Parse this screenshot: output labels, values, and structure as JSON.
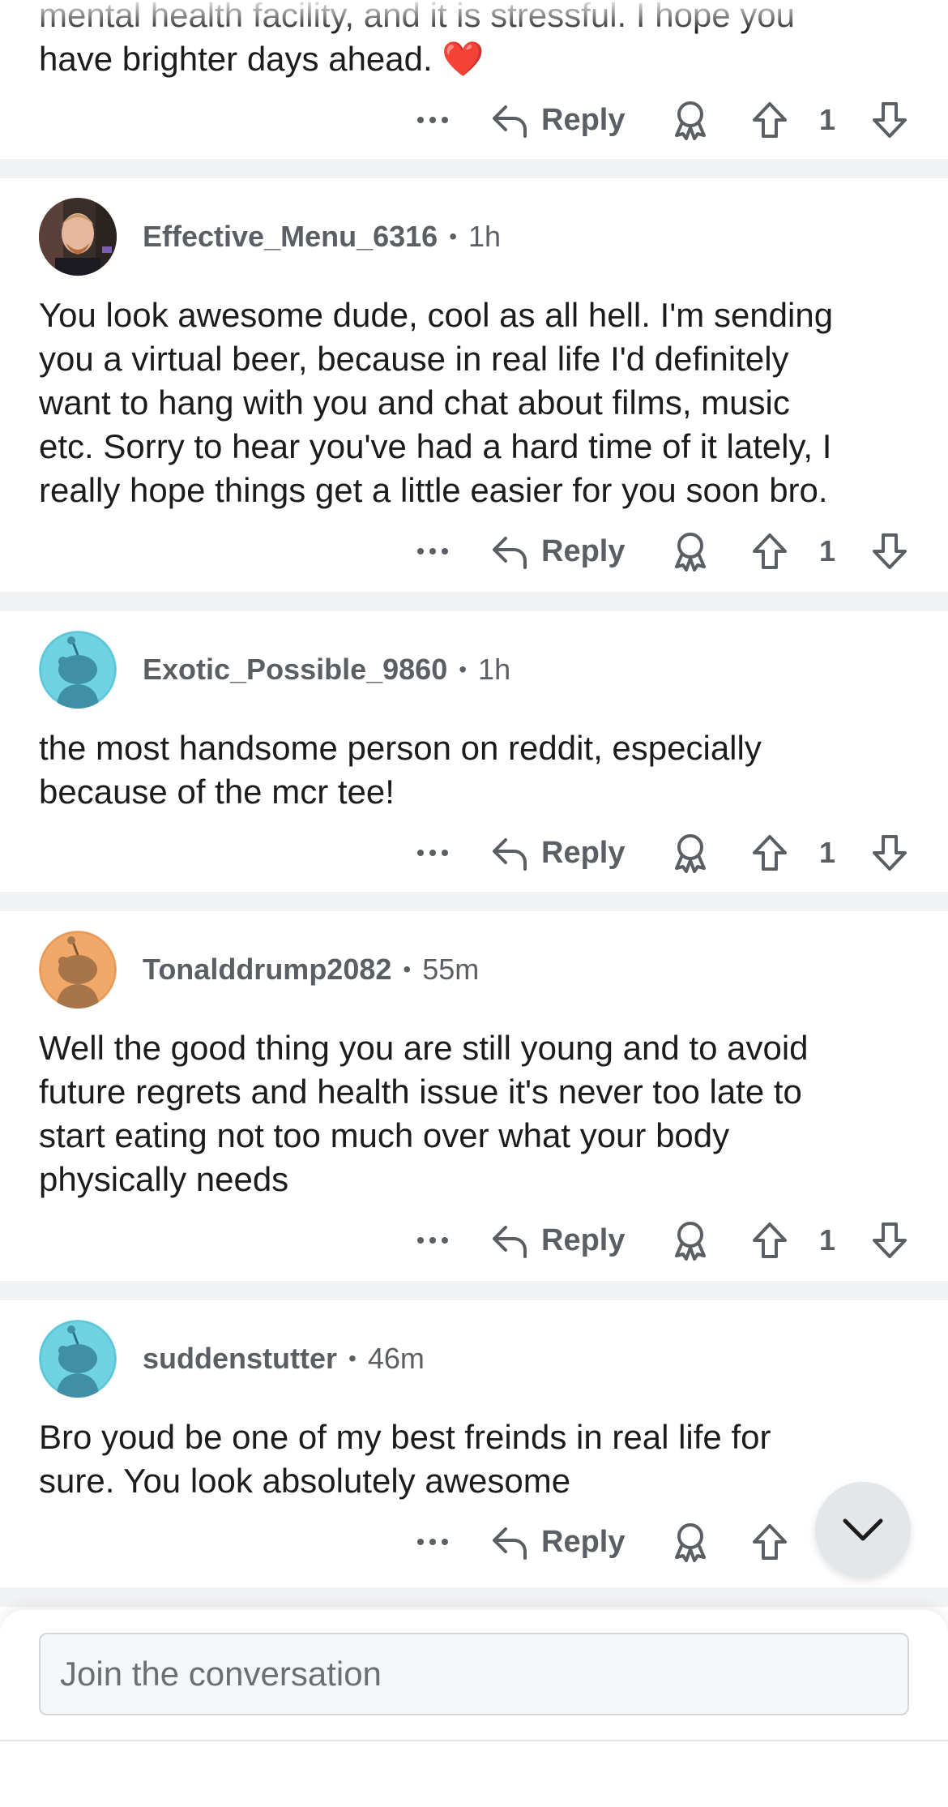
{
  "top_comment": {
    "lines": [
      "mental health facility, and it is stressful. I hope you",
      "have brighter days ahead."
    ],
    "emoji": "❤️",
    "score": "1"
  },
  "comments": [
    {
      "username": "Effective_Menu_6316",
      "age": "1h",
      "avatar": "photo-avatar",
      "lines": [
        "You look awesome dude, cool as all hell. I'm sending",
        "you a virtual beer, because in real life I'd definitely",
        "want to hang with you and chat about films, music",
        "etc. Sorry to hear you've had a hard time of it lately, I",
        "really hope things get a little easier for you soon bro."
      ],
      "score": "1"
    },
    {
      "username": "Exotic_Possible_9860",
      "age": "1h",
      "avatar": "snoo-cyan",
      "lines": [
        "the most handsome person on reddit, especially",
        "because of the mcr tee!"
      ],
      "score": "1"
    },
    {
      "username": "Tonalddrump2082",
      "age": "55m",
      "avatar": "snoo-orange",
      "lines": [
        "Well the good thing you are still young and to avoid",
        "future regrets and health issue it's never too late to",
        "start eating not too much over what your body",
        "physically needs"
      ],
      "score": "1"
    },
    {
      "username": "suddenstutter",
      "age": "46m",
      "avatar": "snoo-cyan",
      "lines": [
        "Bro youd be one of my best freinds in real life for",
        "sure. You look absolutely awesome"
      ],
      "score": ""
    }
  ],
  "actions": {
    "more_icon": "ellipsis-icon",
    "reply_label": "Reply",
    "award_icon": "award-icon",
    "upvote_icon": "upvote-icon",
    "downvote_icon": "downvote-icon"
  },
  "composer": {
    "placeholder": "Join the conversation"
  },
  "scroll_button": {
    "icon": "chevron-down-icon"
  },
  "colors": {
    "background": "#ffffff",
    "separator": "#f1f2f4",
    "meta_text": "#5b5f63",
    "body_text": "#1c1c1c",
    "snoo_cyan": "#6fd3e4",
    "snoo_orange": "#f2a869"
  }
}
